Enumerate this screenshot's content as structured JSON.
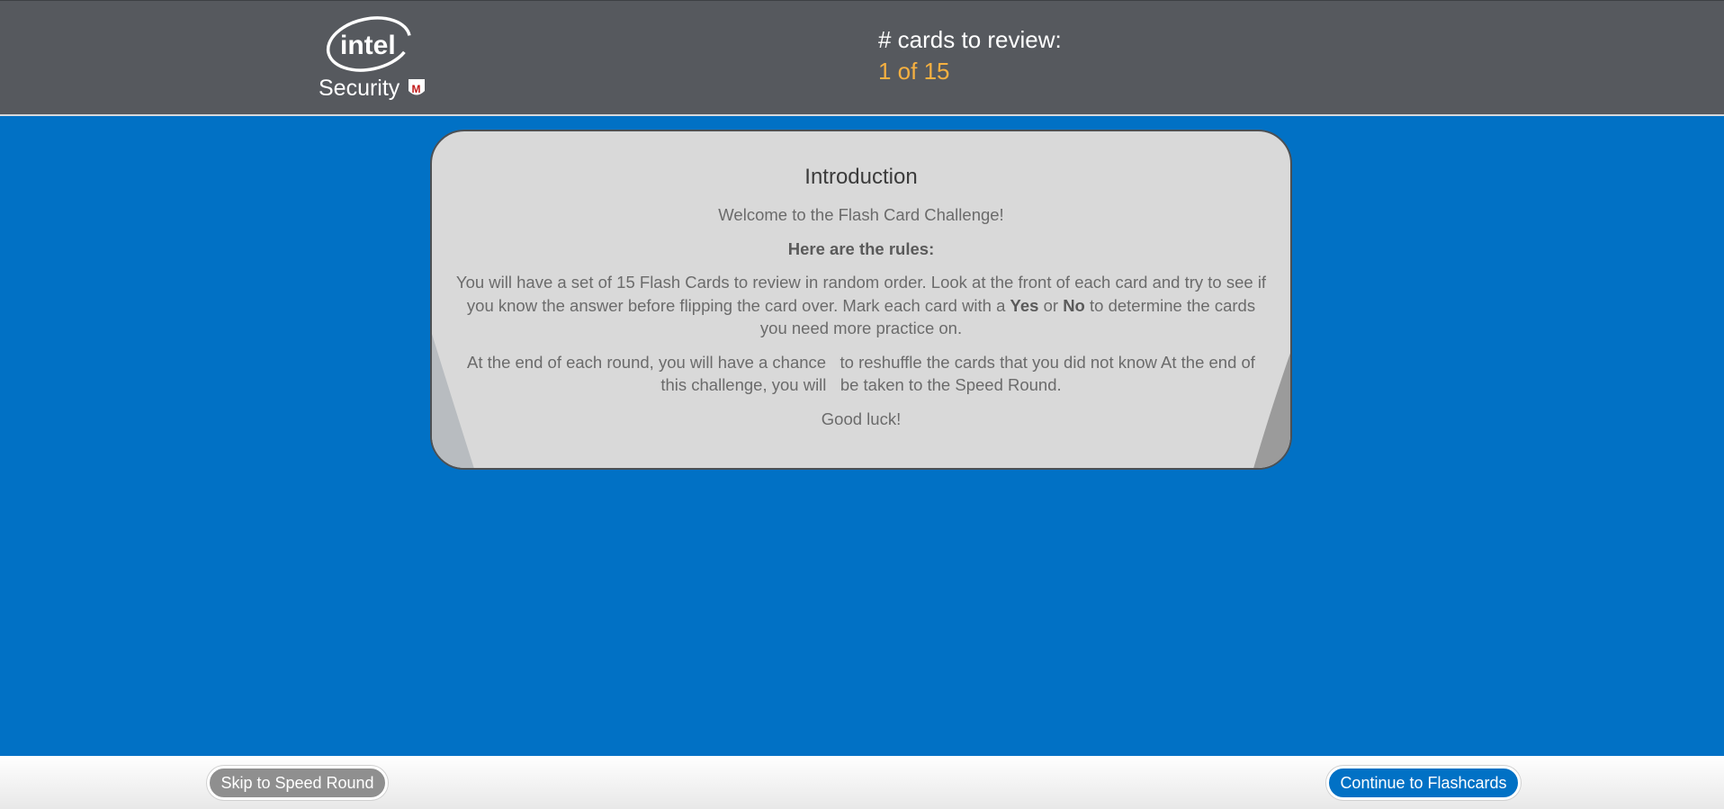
{
  "colors": {
    "header_bg": "#56595e",
    "page_bg": "#0171c5",
    "card_bg": "#d9d9d9",
    "count_accent": "#f5b041",
    "skip_button_bg": "#8f8f8f",
    "continue_button_bg": "#0171c5"
  },
  "header": {
    "logo": {
      "icon": "intel-security-logo",
      "brand_text": "intel",
      "sub_text": "Security",
      "badge_text": "M"
    },
    "review_label": "# cards to review:",
    "review_count": "1 of 15"
  },
  "card": {
    "title": "Introduction",
    "welcome": "Welcome to the Flash Card Challenge!",
    "rules_heading": "Here are the rules:",
    "rules_p1_before": "You will have a set of 15 Flash Cards to review in random order. Look at the front of each card and try to see if you know the answer before flipping the card over. Mark each card with a ",
    "rules_p1_yes": "Yes",
    "rules_p1_or": " or ",
    "rules_p1_no": "No",
    "rules_p1_after": " to determine the cards you need more practice on.",
    "rules_p2": "At the end of each round, you will have a chance   to reshuffle the cards that you did not know At the end of this challenge, you will   be taken to the Speed Round.",
    "closing": "Good luck!"
  },
  "footer": {
    "skip_label": "Skip to Speed Round",
    "continue_label": "Continue to Flashcards"
  }
}
